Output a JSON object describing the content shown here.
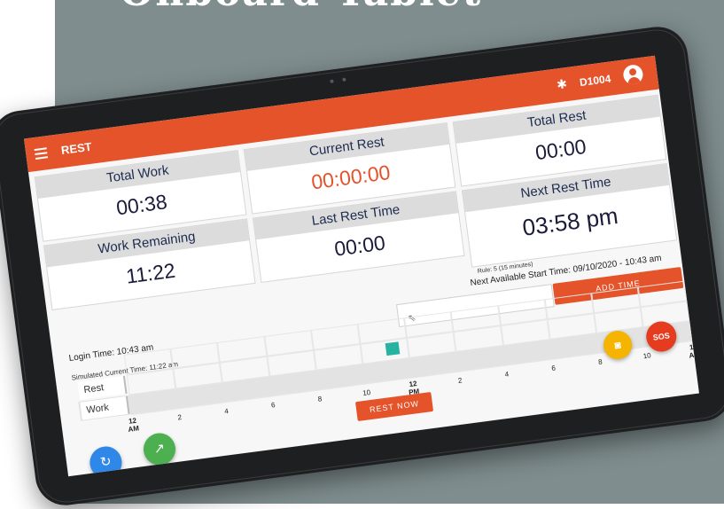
{
  "page": {
    "headline": "Onboard Tablet"
  },
  "appbar": {
    "title": "REST",
    "device_id": "D1004"
  },
  "cards": {
    "total_work": {
      "label": "Total Work",
      "value": "00:38"
    },
    "work_remaining": {
      "label": "Work Remaining",
      "value": "11:22"
    },
    "current_rest": {
      "label": "Current Rest",
      "value": "00:00:00"
    },
    "last_rest_time": {
      "label": "Last Rest Time",
      "value": "00:00"
    },
    "total_rest": {
      "label": "Total Rest",
      "value": "00:00"
    },
    "next_rest_time": {
      "label": "Next Rest Time",
      "value": "03:58 pm"
    }
  },
  "rule_text": "Rule: 5 (15 minutes)",
  "next_available_start": "Next Available Start Time: 09/10/2020 - 10:43 am",
  "add_time_label": "ADD TIME",
  "login_time": "Login Time: 10:43 am",
  "simulated_time": "Simulated Current Time: 11:22 am",
  "timeline": {
    "rows": [
      "Rest",
      "Work"
    ],
    "ticks": [
      {
        "top": "12",
        "bottom": "AM"
      },
      {
        "top": "2",
        "bottom": ""
      },
      {
        "top": "4",
        "bottom": ""
      },
      {
        "top": "6",
        "bottom": ""
      },
      {
        "top": "8",
        "bottom": ""
      },
      {
        "top": "10",
        "bottom": ""
      },
      {
        "top": "12",
        "bottom": "PM"
      },
      {
        "top": "2",
        "bottom": ""
      },
      {
        "top": "4",
        "bottom": ""
      },
      {
        "top": "6",
        "bottom": ""
      },
      {
        "top": "8",
        "bottom": ""
      },
      {
        "top": "10",
        "bottom": ""
      },
      {
        "top": "12",
        "bottom": "AM"
      }
    ]
  },
  "rest_now_label": "REST NOW",
  "sos_label": "SOS",
  "colors": {
    "accent": "#e4532a",
    "rest_block": "#26b3a1",
    "refresh_fab": "#2f88e8",
    "chart_fab": "#4caf50",
    "camera_fab": "#f4b400",
    "sos_fab": "#e53b1e"
  },
  "icons": {
    "menu": "menu-icon",
    "bluetooth": "bluetooth-off-icon",
    "account": "account-circle-icon",
    "refresh": "refresh-icon",
    "trend": "trend-icon",
    "camera": "camera-icon",
    "cursor": "cursor-icon"
  }
}
